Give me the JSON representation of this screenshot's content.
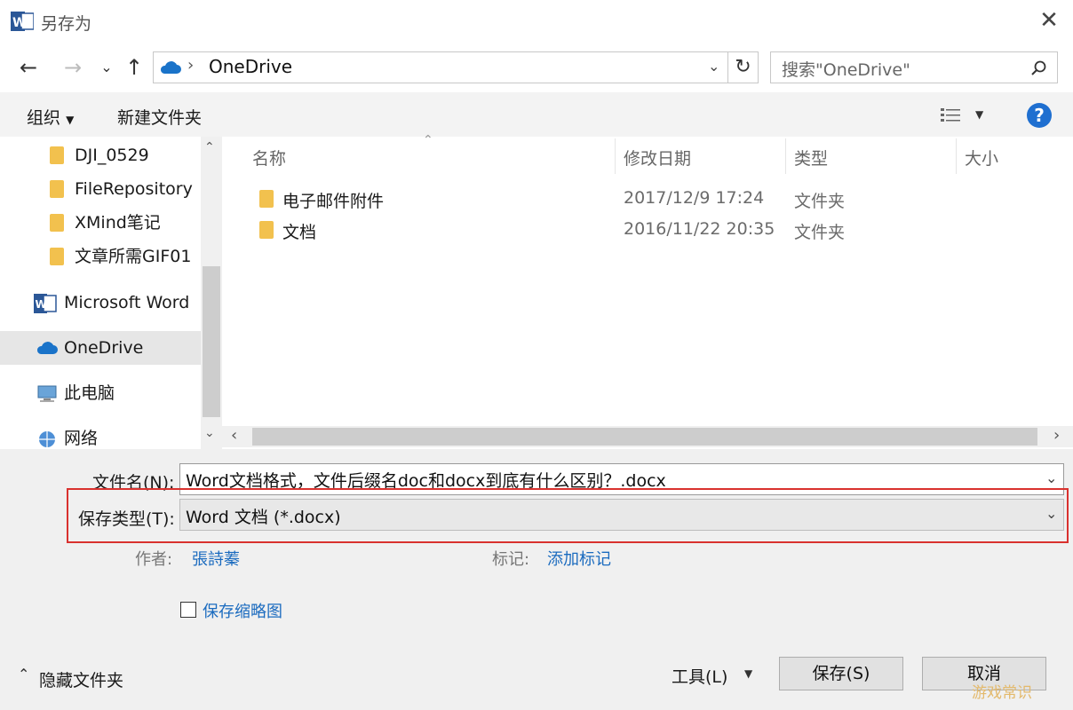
{
  "titlebar": {
    "title": "另存为"
  },
  "nav": {
    "address": "OneDrive",
    "search_placeholder": "搜索\"OneDrive\""
  },
  "toolbar": {
    "organize": "组织",
    "new_folder": "新建文件夹"
  },
  "navpane": {
    "items": [
      {
        "label": "DJI_0529",
        "icon": "folder-icon"
      },
      {
        "label": "FileRepository",
        "icon": "folder-icon"
      },
      {
        "label": "XMind笔记",
        "icon": "folder-icon"
      },
      {
        "label": "文章所需GIF01",
        "icon": "folder-icon"
      },
      {
        "label": "Microsoft Word",
        "icon": "word-icon"
      },
      {
        "label": "OneDrive",
        "icon": "cloud-icon",
        "selected": true
      },
      {
        "label": "此电脑",
        "icon": "computer-icon"
      },
      {
        "label": "网络",
        "icon": "network-icon"
      }
    ]
  },
  "filelist": {
    "columns": {
      "name": "名称",
      "modified": "修改日期",
      "type": "类型",
      "size": "大小"
    },
    "rows": [
      {
        "name": "电子邮件附件",
        "modified": "2017/12/9 17:24",
        "type": "文件夹"
      },
      {
        "name": "文档",
        "modified": "2016/11/22 20:35",
        "type": "文件夹"
      }
    ]
  },
  "form": {
    "filename_label": "文件名(N):",
    "filename_value": "Word文档格式，文件后缀名doc和docx到底有什么区别？.docx",
    "filetype_label": "保存类型(T):",
    "filetype_value": "Word 文档 (*.docx)",
    "author_label": "作者:",
    "author_value": "張詩蓁",
    "tags_label": "标记:",
    "tags_value": "添加标记",
    "thumbnail_label": "保存缩略图"
  },
  "footer": {
    "hide_folders": "隐藏文件夹",
    "tools": "工具(L)",
    "save": "保存(S)",
    "cancel": "取消"
  },
  "watermark": "游戏常识",
  "colors": {
    "highlight_border": "#d9312e",
    "link": "#1b6bbf",
    "accent": "#1f6fd0"
  }
}
